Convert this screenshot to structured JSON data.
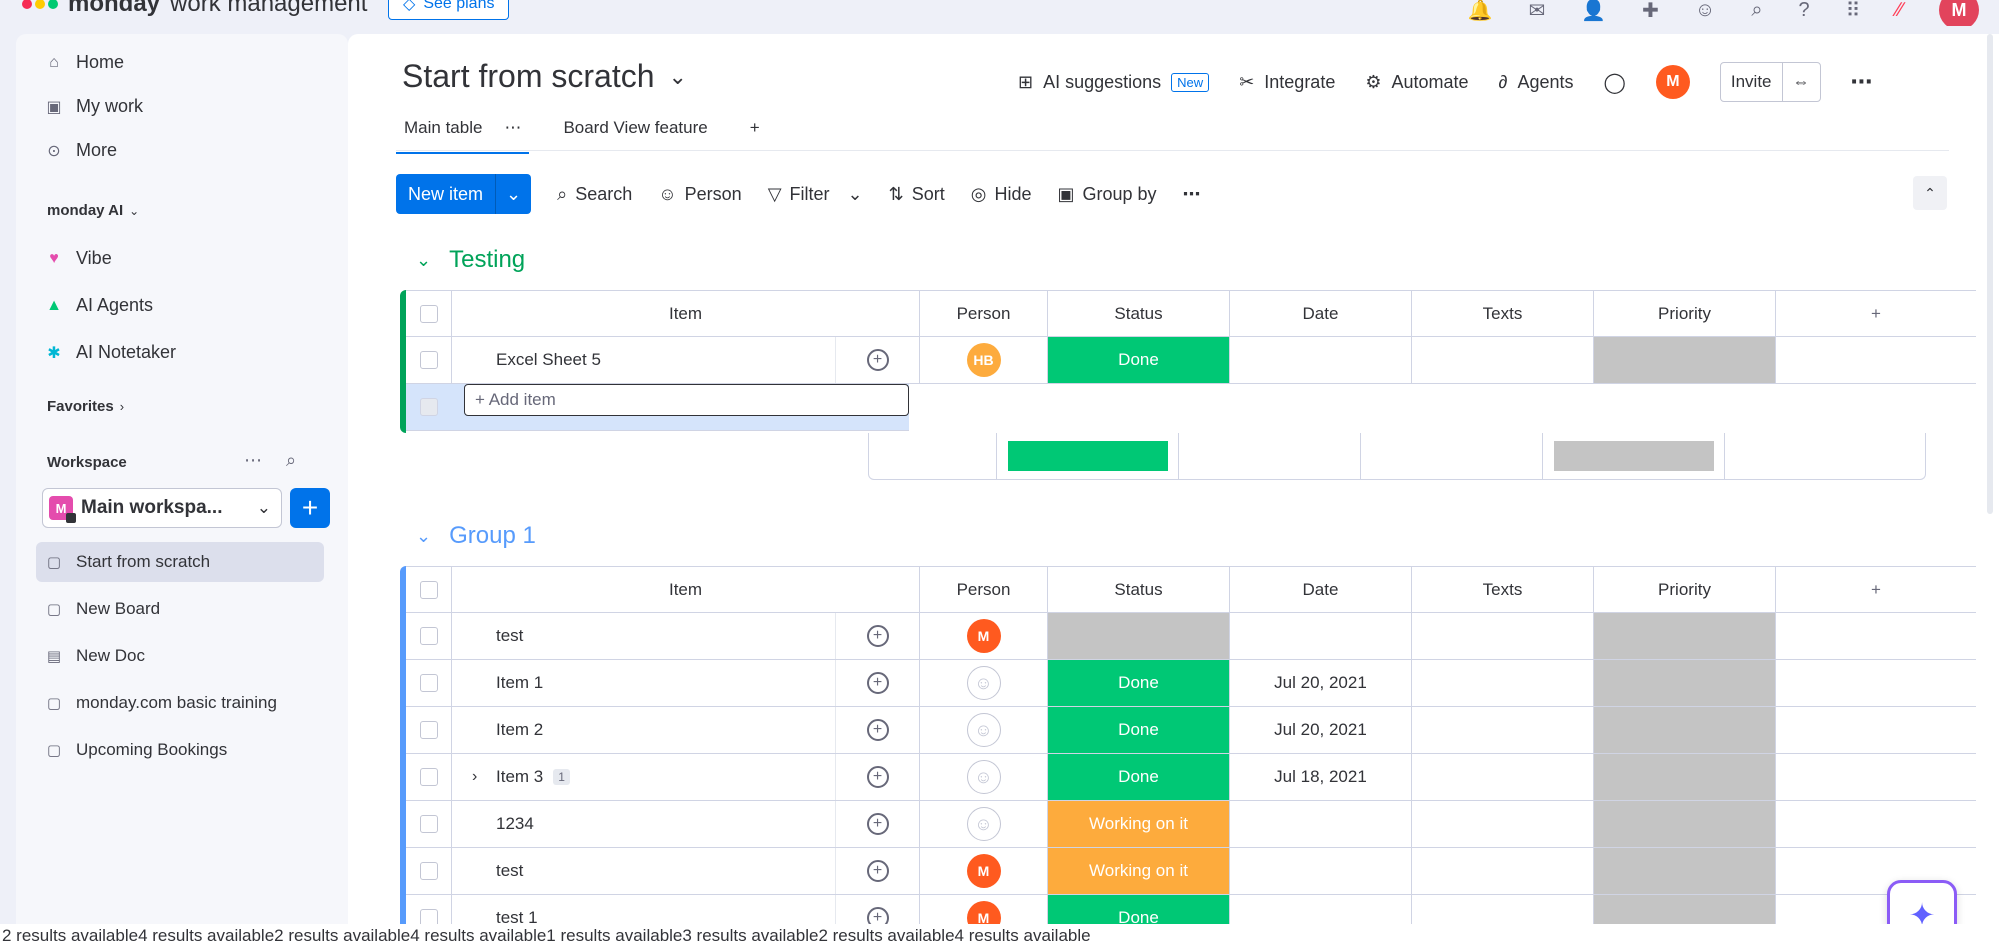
{
  "topbar": {
    "brand_bold": "monday",
    "brand_rest": "work management",
    "see_plans": "See plans",
    "avatar": "M",
    "colors": {
      "accent": "#0073ea",
      "avatar": "#e2445c"
    }
  },
  "sidebar": {
    "nav": [
      {
        "label": "Home",
        "icon": "home-icon"
      },
      {
        "label": "My work",
        "icon": "calendar-check-icon"
      },
      {
        "label": "More",
        "icon": "more-circle-icon"
      }
    ],
    "monday_ai_label": "monday AI",
    "ai_items": [
      {
        "label": "Vibe",
        "icon": "vibe-heart-icon"
      },
      {
        "label": "AI Agents",
        "icon": "ai-agents-icon"
      },
      {
        "label": "AI Notetaker",
        "icon": "notetaker-icon"
      }
    ],
    "favorites_label": "Favorites",
    "workspace_label": "Workspace",
    "workspace_badge": "M",
    "workspace_name": "Main workspa...",
    "boards": [
      {
        "label": "Start from scratch",
        "icon": "board-icon",
        "active": true
      },
      {
        "label": "New Board",
        "icon": "board-icon"
      },
      {
        "label": "New Doc",
        "icon": "doc-icon"
      },
      {
        "label": "monday.com basic training",
        "icon": "board-icon"
      },
      {
        "label": "Upcoming Bookings",
        "icon": "board-icon"
      }
    ]
  },
  "header": {
    "title": "Start from scratch",
    "ai_suggestions": "AI suggestions",
    "new_badge": "New",
    "integrate": "Integrate",
    "automate": "Automate",
    "agents": "Agents",
    "avatar": "M",
    "invite": "Invite"
  },
  "tabs": [
    {
      "label": "Main table",
      "active": true
    },
    {
      "label": "Board View feature"
    }
  ],
  "toolbar": {
    "new_item": "New item",
    "search": "Search",
    "person": "Person",
    "filter": "Filter",
    "sort": "Sort",
    "hide": "Hide",
    "group_by": "Group by"
  },
  "columns": [
    "Item",
    "Person",
    "Status",
    "Date",
    "Texts",
    "Priority"
  ],
  "groups": [
    {
      "title": "Testing",
      "color": "#00a359",
      "rows": [
        {
          "item": "Excel Sheet 5",
          "person": "HB",
          "person_color": "#fdab3d",
          "status": "Done",
          "status_class": "green",
          "date": ""
        }
      ],
      "add_item_placeholder": "+ Add item"
    },
    {
      "title": "Group 1",
      "color": "#579bfc",
      "rows": [
        {
          "item": "test",
          "person": "M",
          "person_color": "#ff5a1f",
          "status": "",
          "status_class": "gray",
          "date": ""
        },
        {
          "item": "Item 1",
          "person": "",
          "status": "Done",
          "status_class": "green",
          "date": "Jul 20, 2021"
        },
        {
          "item": "Item 2",
          "person": "",
          "status": "Done",
          "status_class": "green",
          "date": "Jul 20, 2021"
        },
        {
          "item": "Item 3",
          "subitems": "1",
          "person": "",
          "status": "Done",
          "status_class": "green",
          "date": "Jul 18, 2021"
        },
        {
          "item": "1234",
          "person": "",
          "status": "Working on it",
          "status_class": "orange",
          "date": ""
        },
        {
          "item": "test",
          "person": "M",
          "person_color": "#ff5a1f",
          "status": "Working on it",
          "status_class": "orange",
          "date": ""
        },
        {
          "item": "test 1",
          "person": "M",
          "person_color": "#ff5a1f",
          "status": "Done",
          "status_class": "green",
          "date": ""
        }
      ]
    }
  ],
  "footer": {
    "live_region": "2 results available4 results available2 results available4 results available1 results available3 results available2 results available4 results available"
  }
}
